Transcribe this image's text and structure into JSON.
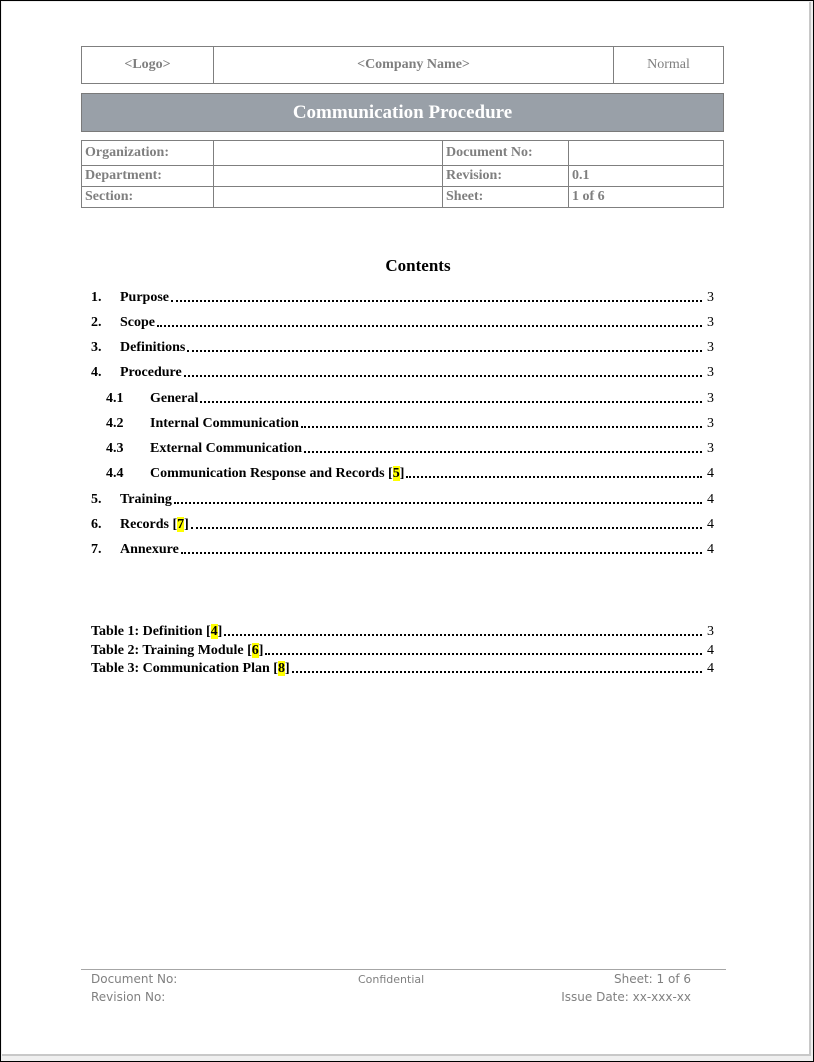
{
  "header": {
    "logo": "<Logo>",
    "company_name": "<Company Name>",
    "style": "Normal"
  },
  "title": "Communication Procedure",
  "info_table": {
    "organization_label": "Organization:",
    "organization_value": "",
    "document_no_label": "Document No:",
    "document_no_value": "",
    "department_label": "Department:",
    "department_value": "",
    "revision_label": "Revision:",
    "revision_value": "0.1",
    "section_label": "Section:",
    "section_value": "",
    "sheet_label": "Sheet:",
    "sheet_value": "1 of 6"
  },
  "contents": {
    "heading": "Contents",
    "entries": [
      {
        "num": "1.",
        "label": "Purpose",
        "tag": "",
        "page": "3"
      },
      {
        "num": "2.",
        "label": "Scope",
        "tag": "",
        "page": "3"
      },
      {
        "num": "3.",
        "label": "Definitions",
        "tag": "",
        "page": "3"
      },
      {
        "num": "4.",
        "label": "Procedure",
        "tag": "",
        "page": "3"
      },
      {
        "num": "4.1",
        "label": "General",
        "tag": "",
        "page": "3"
      },
      {
        "num": "4.2",
        "label": "Internal Communication",
        "tag": "",
        "page": "3"
      },
      {
        "num": "4.3",
        "label": "External Communication",
        "tag": "",
        "page": "3"
      },
      {
        "num": "4.4",
        "label": "Communication Response and Records [",
        "tag": "5",
        "page": "4"
      },
      {
        "num": "5.",
        "label": "Training",
        "tag": "",
        "page": "4"
      },
      {
        "num": "6.",
        "label": "Records [",
        "tag": "7",
        "page": "4"
      },
      {
        "num": "7.",
        "label": "Annexure",
        "tag": "",
        "page": "4"
      }
    ],
    "tables": [
      {
        "label": "Table 1: Definition [",
        "tag": "4",
        "page": "3"
      },
      {
        "label": "Table 2: Training Module [",
        "tag": "6",
        "page": "4"
      },
      {
        "label": "Table 3: Communication Plan [",
        "tag": "8",
        "page": "4"
      }
    ]
  },
  "footer": {
    "document_no": "Document No:",
    "revision_no": "Revision No:",
    "classification": "Confidential",
    "sheet": "Sheet: 1 of 6",
    "issue_date": "Issue Date: xx-xxx-xx"
  },
  "colors": {
    "title_bar": "#99a0a8",
    "highlight": "#ffff00",
    "border_gray": "#7f7f7f"
  }
}
